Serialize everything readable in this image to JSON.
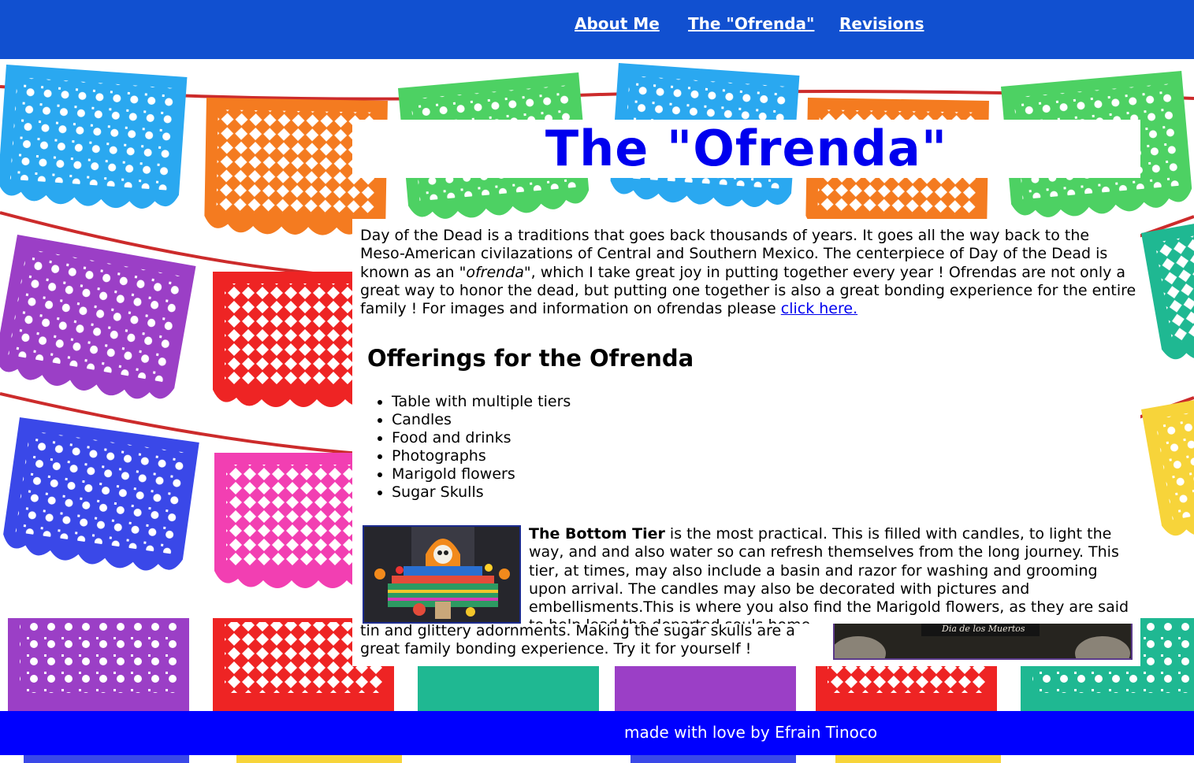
{
  "nav": {
    "items": [
      {
        "label": "About Me"
      },
      {
        "label": "The \"Ofrenda\""
      },
      {
        "label": "Revisions"
      }
    ]
  },
  "page": {
    "title": "The \"Ofrenda\""
  },
  "intro": {
    "text_1": "Day of the Dead is a traditions that goes back thousands of years. It goes all the way back to the Meso-American civilazations of Central and Southern Mexico. The centerpiece of Day of the Dead is known as an ",
    "emphasis": "\"ofrenda\"",
    "text_2": ", which I take great joy in putting together every year ! Ofrendas are not only a great way to honor the dead, but putting one together is also a great bonding experience for the entire family ! For images and information on ofrendas please ",
    "link_label": "click here."
  },
  "offerings": {
    "heading": "Offerings for the Ofrenda",
    "items": [
      "Table with multiple tiers",
      "Candles",
      "Food and drinks",
      "Photographs",
      "Marigold flowers",
      "Sugar Skulls"
    ]
  },
  "bottom_tier": {
    "title": "The Bottom Tier",
    "text": " is the most practical. This is filled with candles, to light the way, and and also water so can refresh themselves from the long journey. This tier, at times, may also include a basin and razor for washing and grooming upon arrival. The candles may also be decorated with pictures and embellisments.This is where you also find the Marigold flowers, as they are said to help lead the departed souls home."
  },
  "sugar_skulls": {
    "text": "tin and glittery adornments. Making the sugar skulls are a great family bonding experience. Try it for yourself !",
    "image_caption": "Dia de los Muertos"
  },
  "footer": {
    "text": "made with love by Efrain Tinoco"
  },
  "colors": {
    "nav_bg": "#1150d0",
    "footer_bg": "#0000ff",
    "title": "#0000ee",
    "link": "#0000ee"
  }
}
